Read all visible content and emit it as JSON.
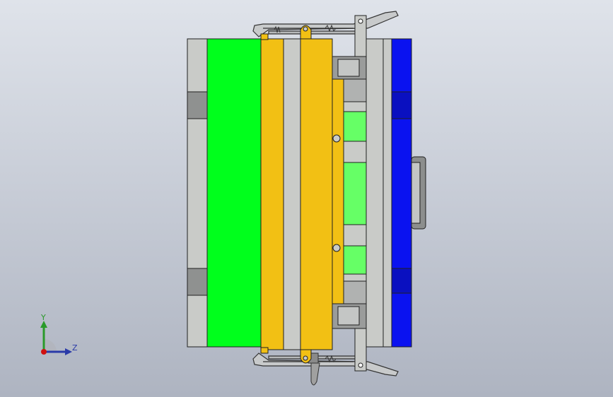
{
  "viewport": {
    "background_top": "#dfe3ea",
    "background_bottom": "#aeb4c1"
  },
  "model": {
    "plate_colors": {
      "steel_plate": "#c9cbc8",
      "cavity_insert": "#00ff1c",
      "stripper_plate": "#f2c014",
      "core_insert": "#66ff66",
      "clamp_plate": "#0a12f0",
      "outline": "#202020"
    },
    "components": [
      "fixed-clamp-plate",
      "cavity-insert",
      "stripper-plate",
      "runner-plate",
      "ejector-plate",
      "core-inserts",
      "support-plate",
      "moving-clamp-plate",
      "locating-ring",
      "latch-arms",
      "springs",
      "guide-pins",
      "lifting-eye"
    ]
  },
  "triad": {
    "y_label": "Y",
    "z_label": "Z",
    "y_color": "#2a9a2a",
    "z_color": "#2a3aa8",
    "x_color": "#d01010"
  }
}
